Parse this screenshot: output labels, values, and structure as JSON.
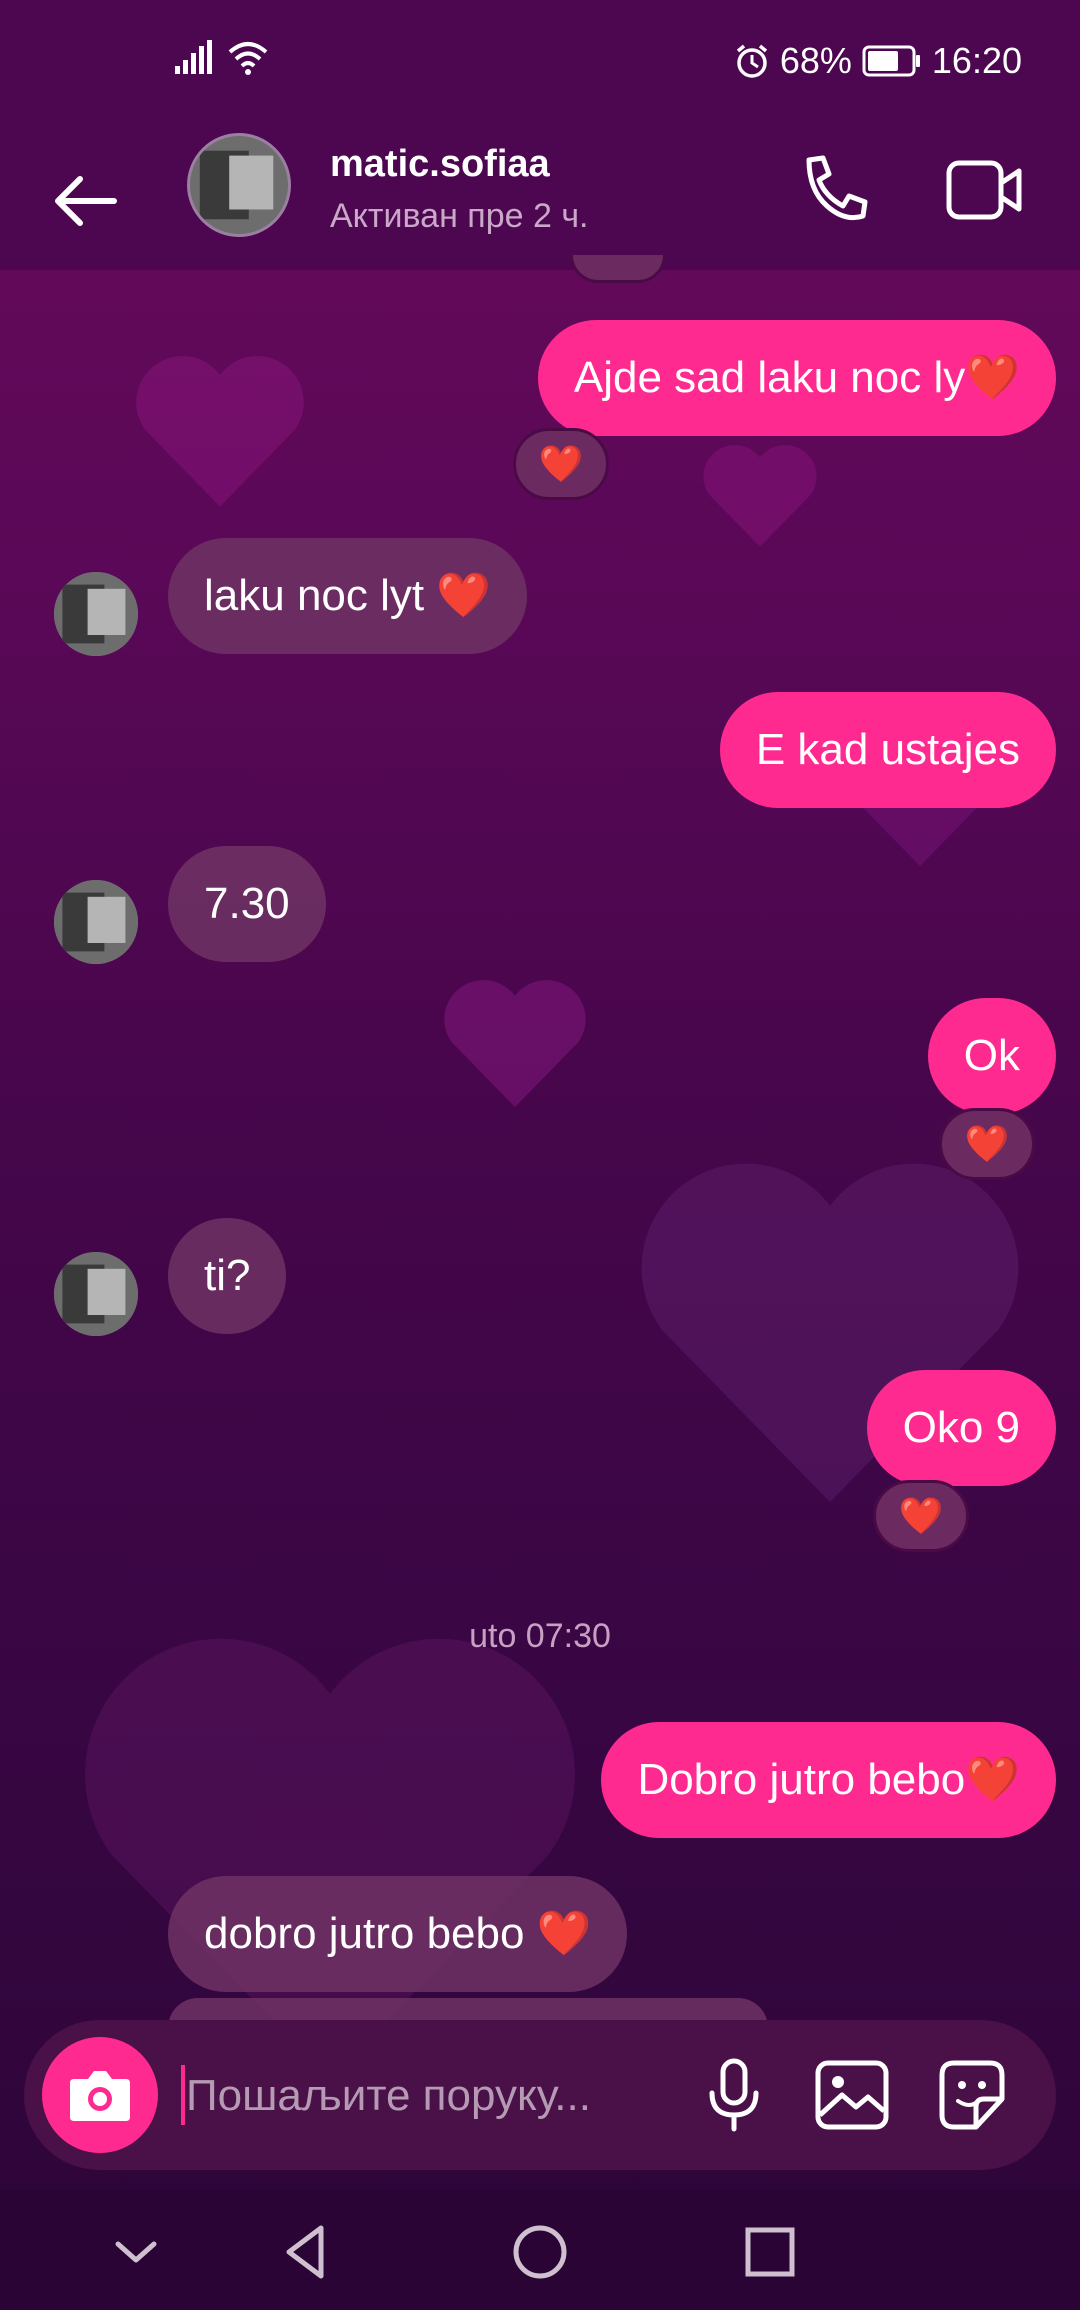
{
  "status_bar": {
    "battery": "68%",
    "time": "16:20"
  },
  "header": {
    "username": "matic.sofiaa",
    "activity": "Активан пре 2 ч."
  },
  "messages": [
    {
      "dir": "out",
      "text": "Ajde sad laku noc ly❤️",
      "reaction": "❤️"
    },
    {
      "dir": "in",
      "text": "laku noc lyt ❤️"
    },
    {
      "dir": "out",
      "text": "E kad ustajes"
    },
    {
      "dir": "in",
      "text": "7.30"
    },
    {
      "dir": "out",
      "text": "Ok",
      "reaction": "❤️"
    },
    {
      "dir": "in",
      "text": "ti?"
    },
    {
      "dir": "out",
      "text": "Oko 9",
      "reaction": "❤️"
    },
    {
      "dir": "out",
      "text": "Dobro jutro bebo❤️"
    },
    {
      "dir": "in",
      "text": "dobro jutro bebo ❤️"
    }
  ],
  "timestamp": "uto 07:30",
  "composer": {
    "placeholder": "Пошаљите поруку..."
  },
  "icons": {
    "back": "arrow-left-icon",
    "call": "phone-icon",
    "video": "video-camera-icon",
    "camera": "camera-icon",
    "mic": "microphone-icon",
    "gallery": "image-icon",
    "sticker": "sticker-icon"
  },
  "colors": {
    "outgoing_bubble": "#ff2a8f",
    "incoming_bubble": "#6e3264",
    "header_bg": "#4d0650"
  }
}
